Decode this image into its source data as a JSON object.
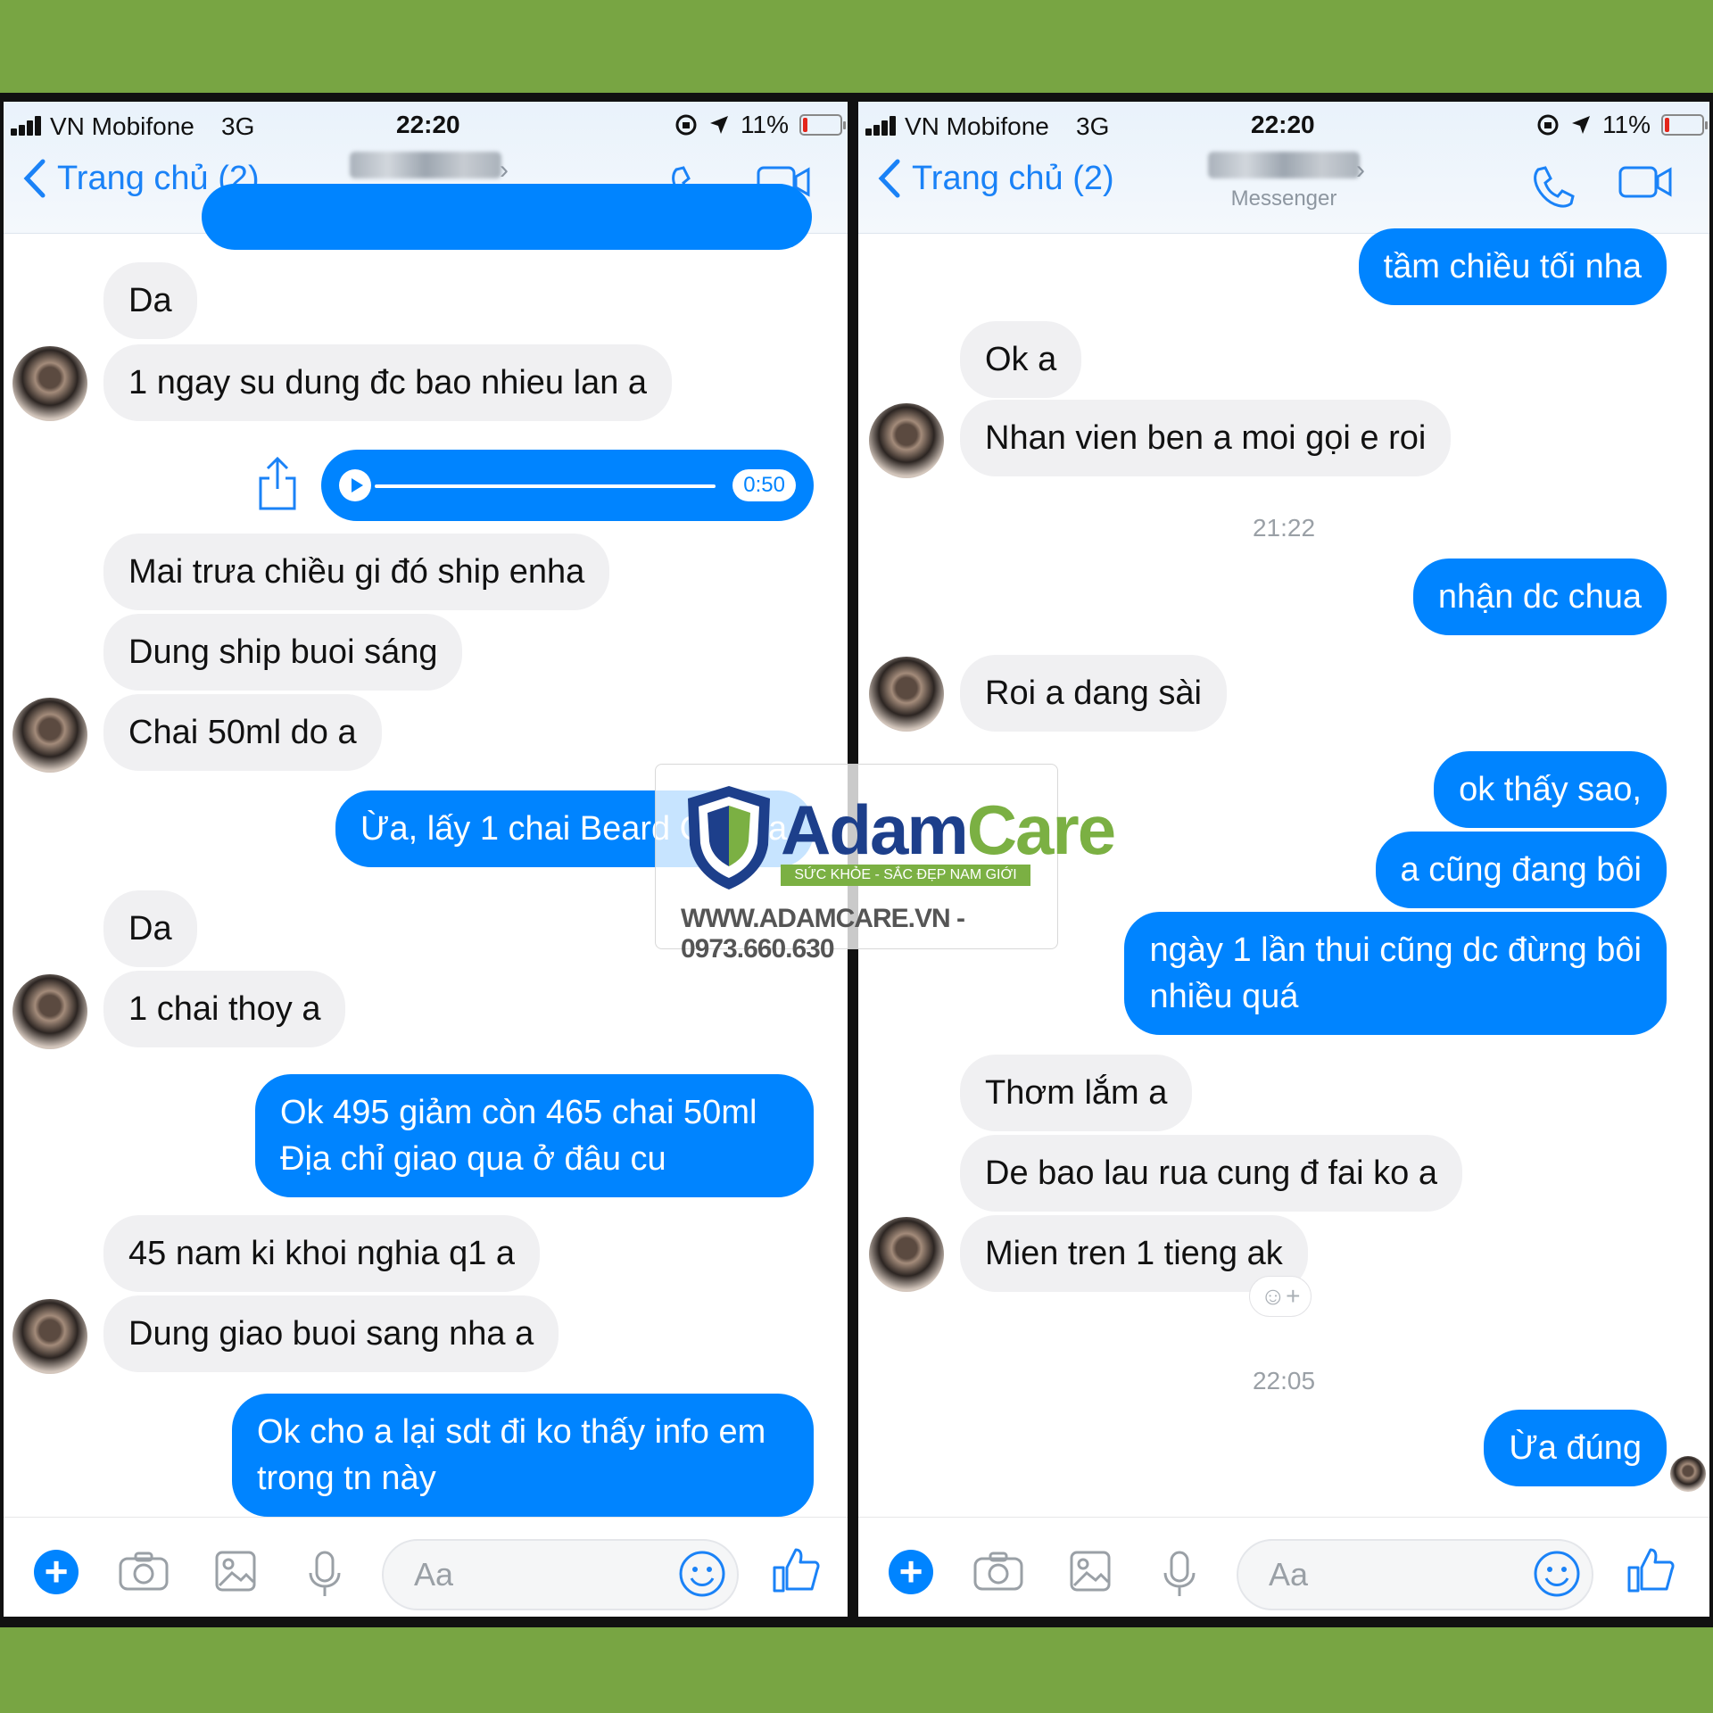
{
  "status": {
    "carrier": "VN Mobifone",
    "network": "3G",
    "time": "22:20",
    "battery": "11%",
    "battery_level": 0.11
  },
  "header": {
    "back_label": "Trang chủ (2)",
    "subtitle": "Messenger"
  },
  "composer": {
    "placeholder": "Aa"
  },
  "left_chat": {
    "m1": "Da",
    "m2": "1 ngay su dung đc bao nhieu lan a",
    "voice_duration": "0:50",
    "m3": "Mai trưa chiều gi đó ship enha",
    "m4": "Dung ship buoi sáng",
    "m5": "Chai 50ml do a",
    "m6": "Ừa, lấy 1 chai Beard Oil nha",
    "m7": "Da",
    "m8": "1 chai thoy a",
    "m9_line1": "Ok 495 giảm còn 465 chai 50ml",
    "m9_line2": "Địa chỉ giao qua ở đâu cu",
    "m10": "45 nam ki khoi nghia q1 a",
    "m11": "Dung giao buoi sang nha a",
    "m12_line1": "Ok cho a lại sdt đi ko thấy info em",
    "m12_line2": "trong tn này"
  },
  "right_chat": {
    "m1": "tầm chiều tối nha",
    "m2": "Ok a",
    "m3": "Nhan vien ben a moi gọi e roi",
    "ts1": "21:22",
    "m4": "nhận dc chua",
    "m5": "Roi a dang sài",
    "m6": "ok thấy sao,",
    "m7": "a cũng đang bôi",
    "m8_line1": "ngày 1 lần thui cũng dc đừng bôi",
    "m8_line2": "nhiều quá",
    "m9": "Thơm lắm a",
    "m10": "De bao lau rua cung đ fai ko a",
    "m11": "Mien tren 1 tieng ak",
    "ts2": "22:05",
    "m12": "Ừa đúng"
  },
  "watermark": {
    "brand_part1": "Adam",
    "brand_part2": "Care",
    "tagline": "SỨC KHỎE - SẮC ĐẸP NAM GIỚI",
    "url": "WWW.ADAMCARE.VN - 0973.660.630"
  },
  "colors": {
    "background": "#78a543",
    "outgoing_bubble": "#0084ff",
    "incoming_bubble": "#f0f0f2",
    "link": "#1a82f7"
  }
}
